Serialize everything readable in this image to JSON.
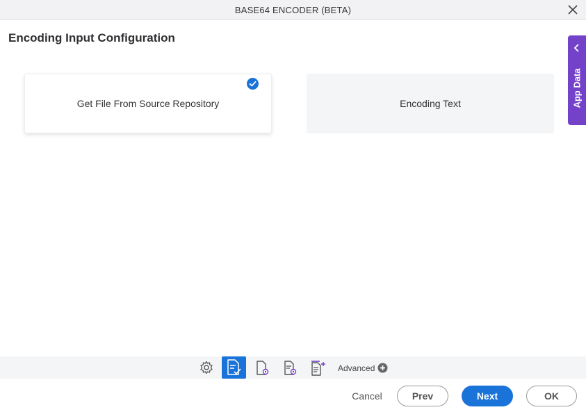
{
  "window": {
    "title": "BASE64 ENCODER (BETA)"
  },
  "page": {
    "title": "Encoding Input Configuration"
  },
  "options": [
    {
      "label": "Get File From Source Repository",
      "selected": true
    },
    {
      "label": "Encoding Text",
      "selected": false
    }
  ],
  "side_tab": {
    "label": "App Data"
  },
  "toolbar": {
    "icons": [
      "settings-gear-icon",
      "document-check-icon",
      "document-settings-icon",
      "document-gear-icon",
      "base64-document-icon"
    ],
    "active_index": 1,
    "advanced_label": "Advanced"
  },
  "footer": {
    "cancel_label": "Cancel",
    "prev_label": "Prev",
    "next_label": "Next",
    "ok_label": "OK"
  },
  "colors": {
    "accent": "#1a73d9",
    "side_tab": "#7342c9",
    "toolbar_bg": "#f4f5f7"
  }
}
